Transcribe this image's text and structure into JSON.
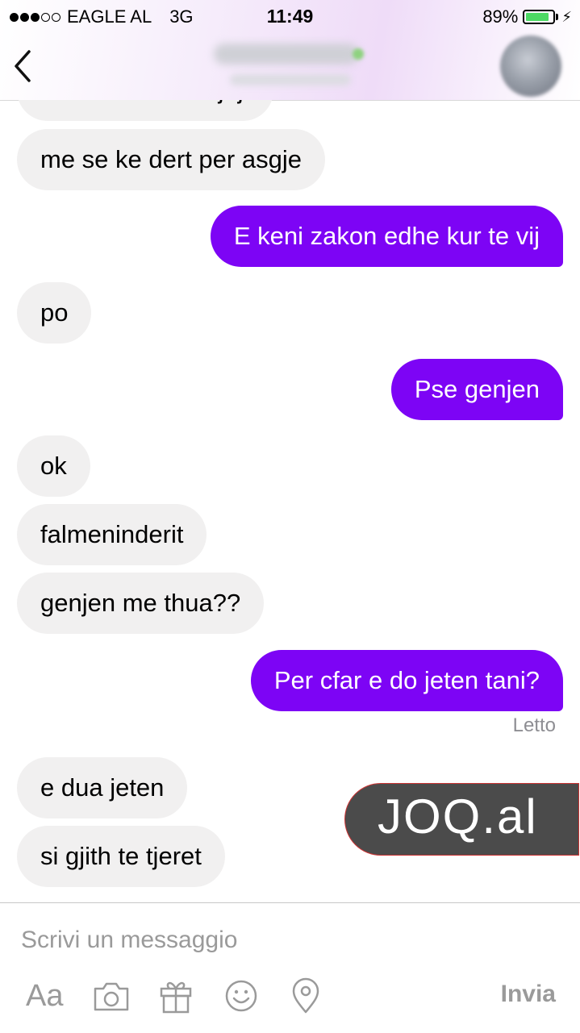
{
  "status_bar": {
    "carrier": "EAGLE AL",
    "network": "3G",
    "time": "11:49",
    "battery": "89%",
    "battery_level": 0.89,
    "signal_bars": 3
  },
  "conversation": {
    "messages": [
      {
        "direction": "in",
        "text": "se me behesh njejt"
      },
      {
        "direction": "in",
        "text": "me se ke dert per asgje"
      },
      {
        "direction": "out",
        "text": "E keni zakon edhe kur te vij"
      },
      {
        "direction": "in",
        "text": "po"
      },
      {
        "direction": "out",
        "text": "Pse genjen"
      },
      {
        "direction": "in",
        "text": "ok"
      },
      {
        "direction": "in",
        "text": "falmeninderit"
      },
      {
        "direction": "in",
        "text": "genjen me thua??"
      },
      {
        "direction": "out",
        "text": "Per cfar e do jeten tani?"
      },
      {
        "direction": "in",
        "text": "e dua jeten"
      },
      {
        "direction": "in",
        "text": "si gjith te tjeret"
      }
    ],
    "read_receipt": "Letto"
  },
  "watermark": {
    "text": "JOQ.al"
  },
  "composer": {
    "placeholder": "Scrivi un messaggio",
    "value": "",
    "font_label": "Aa",
    "send_label": "Invia",
    "tools": [
      "font-size-icon",
      "camera-icon",
      "gift-icon",
      "emoji-icon",
      "location-pin-icon"
    ]
  },
  "colors": {
    "outgoing_bubble": "#7d04f5",
    "incoming_bubble": "#f1f0f0",
    "battery": "#4cd964"
  }
}
